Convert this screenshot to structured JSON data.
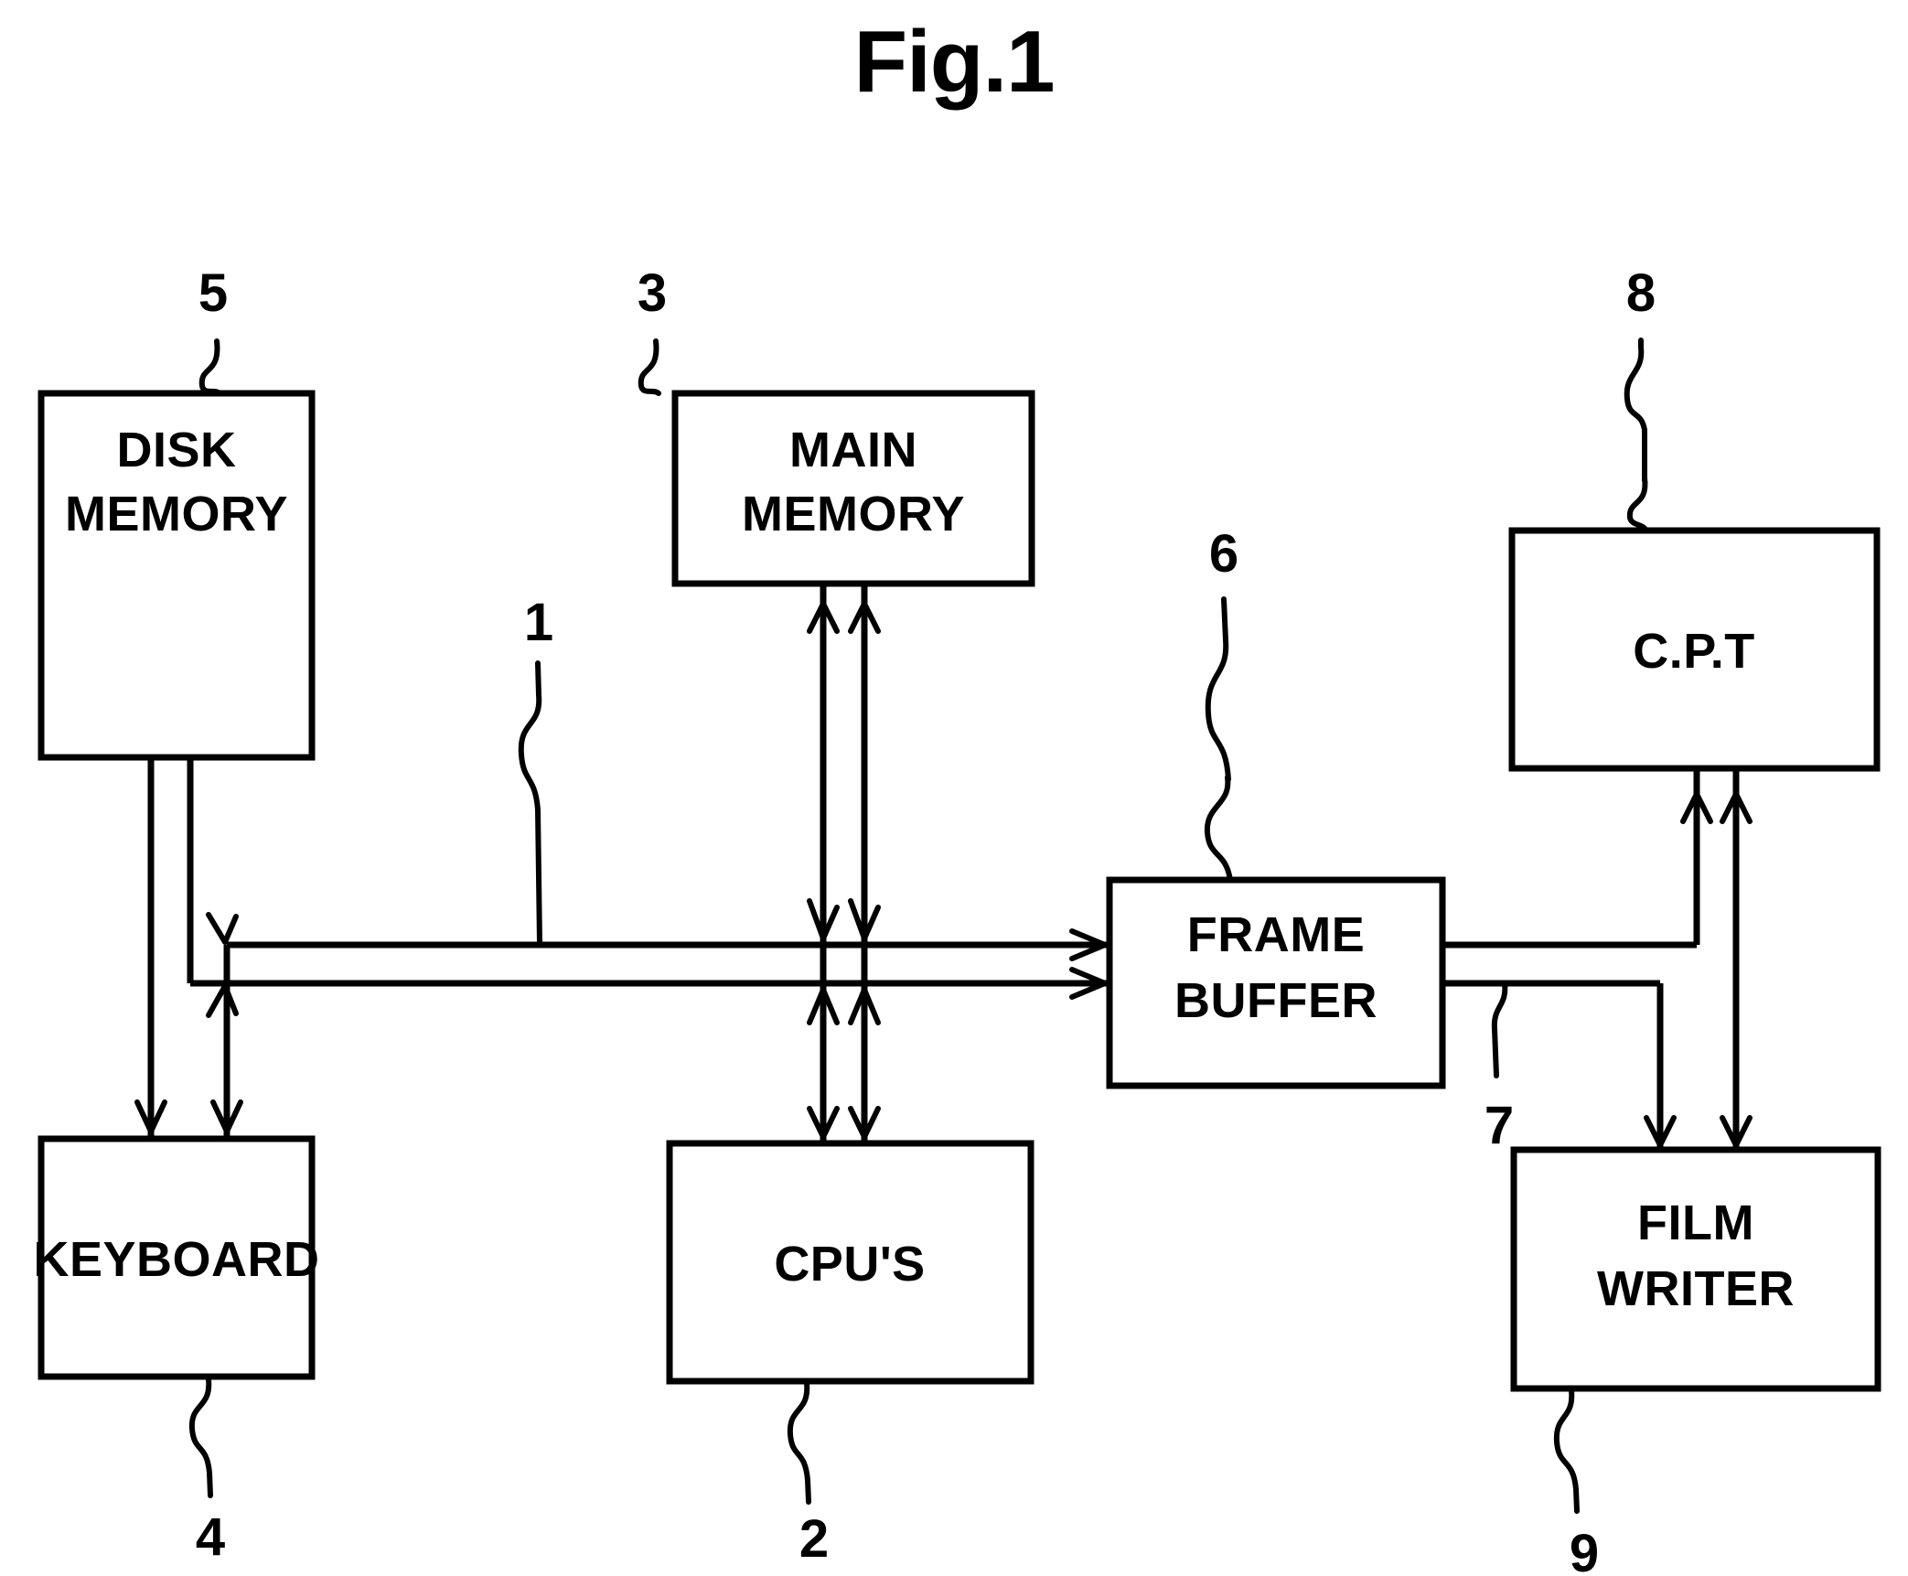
{
  "figure": {
    "title": "Fig.1",
    "type": "patent-block-diagram",
    "background_color": "#ffffff",
    "line_color": "#000000"
  },
  "blocks": [
    {
      "id": "disk-memory",
      "label_line1": "DISK",
      "label_line2": "MEMORY",
      "ref": "5"
    },
    {
      "id": "main-memory",
      "label_line1": "MAIN",
      "label_line2": "MEMORY",
      "ref": "3"
    },
    {
      "id": "cpt",
      "label_line1": "C.P.T",
      "label_line2": "",
      "ref": "8"
    },
    {
      "id": "frame-buffer",
      "label_line1": "FRAME",
      "label_line2": "BUFFER",
      "ref": "6"
    },
    {
      "id": "keyboard",
      "label_line1": "KEYBOARD",
      "label_line2": "",
      "ref": "4"
    },
    {
      "id": "cpus",
      "label_line1": "CPU'S",
      "label_line2": "",
      "ref": "2"
    },
    {
      "id": "film-writer",
      "label_line1": "FILM",
      "label_line2": "WRITER",
      "ref": "9"
    }
  ],
  "reference_numerals": {
    "bus_main": "1",
    "cpus": "2",
    "main_memory": "3",
    "keyboard": "4",
    "disk_memory": "5",
    "frame_buffer": "6",
    "frame_buffer_bus": "7",
    "cpt": "8",
    "film_writer": "9"
  },
  "labels": {
    "disk_memory_l1": "DISK",
    "disk_memory_l2": "MEMORY",
    "main_memory_l1": "MAIN",
    "main_memory_l2": "MEMORY",
    "cpt": "C.P.T",
    "frame_buffer_l1": "FRAME",
    "frame_buffer_l2": "BUFFER",
    "keyboard": "KEYBOARD",
    "cpus": "CPU'S",
    "film_writer_l1": "FILM",
    "film_writer_l2": "WRITER"
  }
}
